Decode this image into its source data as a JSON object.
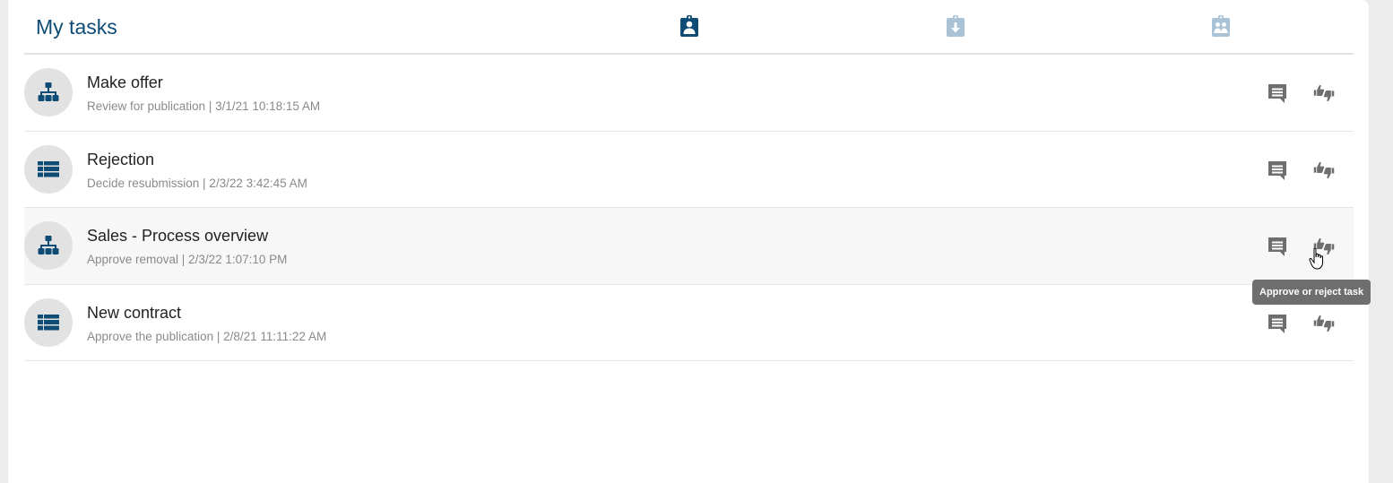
{
  "header": {
    "title": "My tasks",
    "tabs": [
      {
        "icon": "clipboard-user-icon",
        "active": true
      },
      {
        "icon": "clipboard-download-icon",
        "active": false
      },
      {
        "icon": "clipboard-group-icon",
        "active": false
      }
    ]
  },
  "colors": {
    "accent": "#0f4c75",
    "inactive_tab": "#a9c2d6",
    "action_icon": "#6e6e6e"
  },
  "tasks": [
    {
      "title": "Make offer",
      "subtitle": "Review for publication | 3/1/21 10:18:15 AM",
      "icon": "hierarchy-icon"
    },
    {
      "title": "Rejection",
      "subtitle": "Decide resubmission | 2/3/22 3:42:45 AM",
      "icon": "list-table-icon"
    },
    {
      "title": "Sales - Process overview",
      "subtitle": "Approve removal | 2/3/22 1:07:10 PM",
      "icon": "hierarchy-icon"
    },
    {
      "title": "New contract",
      "subtitle": "Approve the publication | 2/8/21 11:11:22 AM",
      "icon": "list-table-icon"
    }
  ],
  "actions": {
    "comment_icon": "comment-icon",
    "approve_reject_icon": "thumbs-up-down-icon"
  },
  "tooltip": {
    "text": "Approve or reject task"
  }
}
